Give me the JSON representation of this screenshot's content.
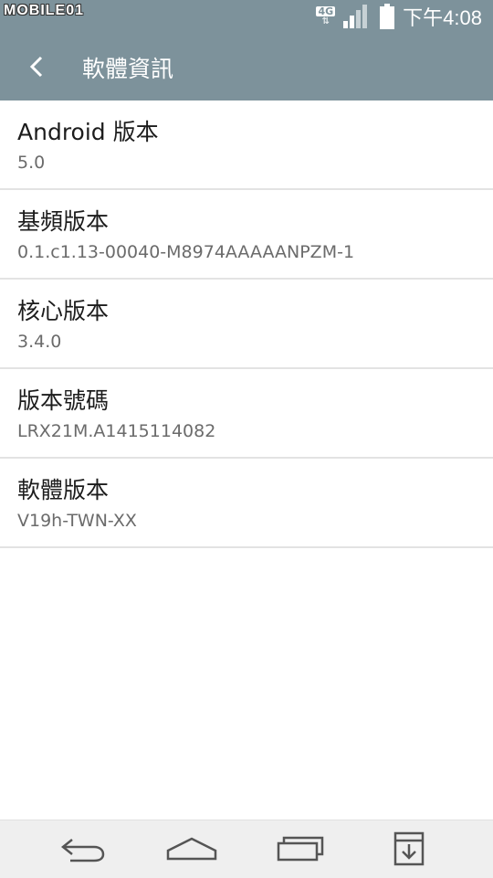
{
  "status_bar": {
    "watermark": "MOBILE01",
    "network_type": "4G",
    "network_arrows": "⇅",
    "time": "下午4:08",
    "icons": [
      "4g-icon",
      "signal-icon",
      "battery-icon"
    ]
  },
  "action_bar": {
    "back_icon": "chevron-left-icon",
    "title": "軟體資訊"
  },
  "items": [
    {
      "title": "Android 版本",
      "value": "5.0"
    },
    {
      "title": "基頻版本",
      "value": "0.1.c1.13-00040-M8974AAAAANPZM-1"
    },
    {
      "title": "核心版本",
      "value": "3.4.0"
    },
    {
      "title": "版本號碼",
      "value": "LRX21M.A1415114082"
    },
    {
      "title": "軟體版本",
      "value": "V19h-TWN-XX"
    }
  ],
  "nav_bar": {
    "icons": [
      "back-arrow-icon",
      "home-icon",
      "recent-apps-icon",
      "notification-shade-icon"
    ]
  },
  "colors": {
    "header": "#7d929b",
    "divider": "#e3e3e3",
    "title_text": "#1c1c1c",
    "value_text": "#6b6b6b",
    "nav_background": "#efefef"
  }
}
